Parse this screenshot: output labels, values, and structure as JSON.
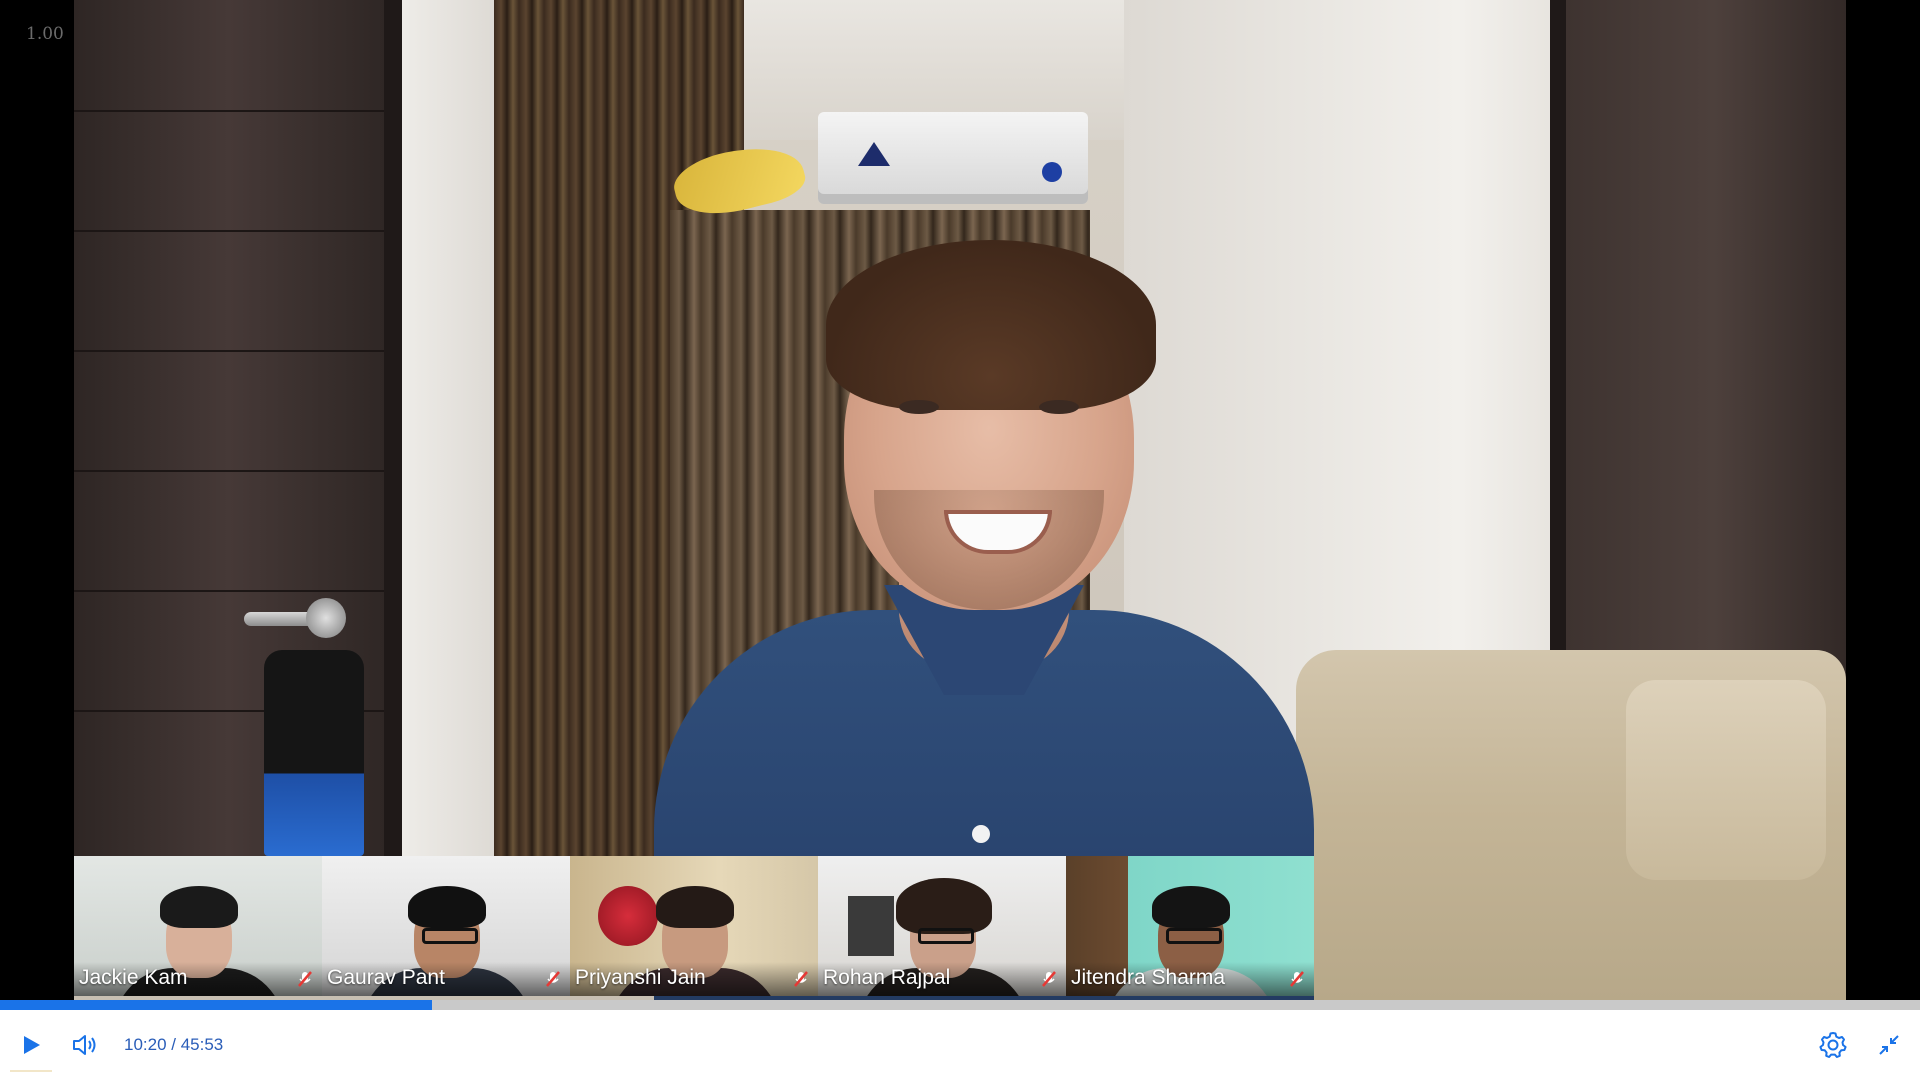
{
  "player": {
    "speed": "1.00",
    "current_time": "10:20",
    "total_time": "45:53",
    "time_separator": " / ",
    "progress": 0.225,
    "accent_color": "#1a73e8",
    "controls": {
      "play_icon": "play-icon",
      "volume_icon": "volume-icon",
      "settings_icon": "gear-icon",
      "exit_fullscreen_icon": "exit-fullscreen-icon"
    }
  },
  "participants": [
    {
      "name": "Jackie Kam",
      "mic": "muted"
    },
    {
      "name": "Gaurav Pant",
      "mic": "muted"
    },
    {
      "name": "Priyanshi Jain",
      "mic": "muted"
    },
    {
      "name": "Rohan Rajpal",
      "mic": "muted"
    },
    {
      "name": "Jitendra Sharma",
      "mic": "muted"
    }
  ]
}
